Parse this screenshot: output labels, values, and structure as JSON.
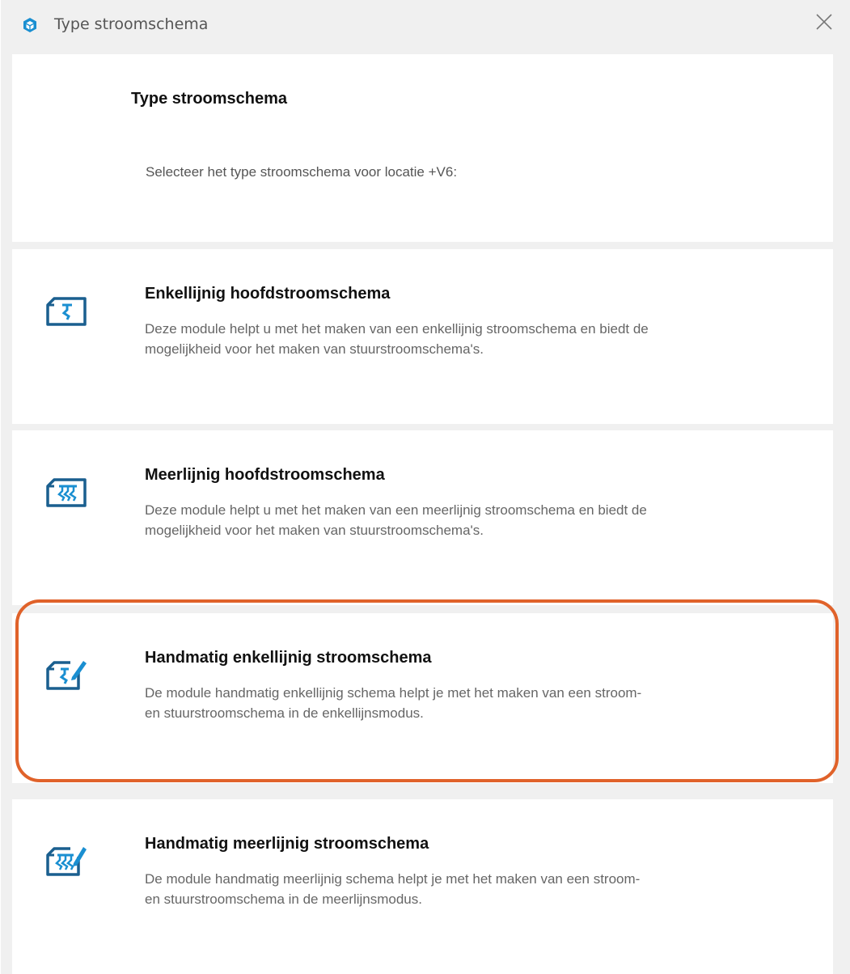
{
  "window": {
    "title": "Type stroomschema",
    "icon": "cube-icon",
    "close_icon": "close-icon"
  },
  "header": {
    "title": "Type stroomschema",
    "subtitle": "Selecteer het type stroomschema voor locatie +V6:"
  },
  "options": [
    {
      "title": "Enkellijnig hoofdstroomschema",
      "desc_line1": "Deze module helpt u met het maken van een enkellijnig stroomschema en biedt de",
      "desc_line2": "mogelijkheid voor het maken van stuurstroomschema's.",
      "icon": "single-line-schema-icon"
    },
    {
      "title": "Meerlijnig hoofdstroomschema",
      "desc_line1": "Deze module helpt u met het maken van een meerlijnig stroomschema en biedt de",
      "desc_line2": "mogelijkheid voor het maken van stuurstroomschema's.",
      "icon": "multi-line-schema-icon"
    },
    {
      "title": "Handmatig enkellijnig stroomschema",
      "desc_line1": "De module handmatig enkellijnig schema helpt je met het maken van een  stroom-",
      "desc_line2": "en stuurstroomschema in de enkellijnsmodus.",
      "icon": "manual-single-line-schema-icon"
    },
    {
      "title": "Handmatig meerlijnig stroomschema",
      "desc_line1": "De module handmatig meerlijnig schema helpt je met het maken van een  stroom-",
      "desc_line2": "en stuurstroomschema in de meerlijnsmodus.",
      "icon": "manual-multi-line-schema-icon"
    }
  ],
  "colors": {
    "accent": "#1a8fd1",
    "highlight": "#e0622a"
  }
}
